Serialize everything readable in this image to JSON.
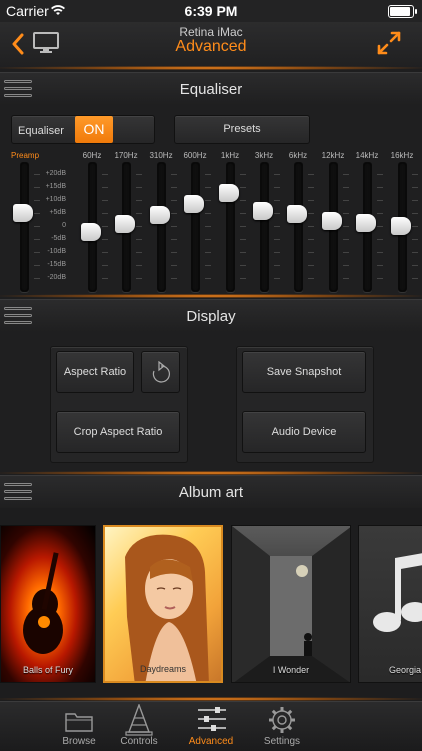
{
  "status": {
    "carrier": "Carrier",
    "time": "6:39 PM"
  },
  "nav": {
    "device": "Retina iMac",
    "title": "Advanced"
  },
  "equaliser": {
    "title": "Equaliser",
    "label": "Equaliser",
    "toggle": "ON",
    "presets": "Presets",
    "preamp_label": "Preamp",
    "preamp_level": 0.62,
    "db_labels": [
      "+20dB",
      "+15dB",
      "+10dB",
      "+5dB",
      "0",
      "-5dB",
      "-10dB",
      "-15dB",
      "-20dB"
    ],
    "bands": [
      {
        "freq": "60Hz",
        "level": 0.45
      },
      {
        "freq": "170Hz",
        "level": 0.52
      },
      {
        "freq": "310Hz",
        "level": 0.6
      },
      {
        "freq": "600Hz",
        "level": 0.7
      },
      {
        "freq": "1kHz",
        "level": 0.8
      },
      {
        "freq": "3kHz",
        "level": 0.64
      },
      {
        "freq": "6kHz",
        "level": 0.61
      },
      {
        "freq": "12kHz",
        "level": 0.55
      },
      {
        "freq": "14kHz",
        "level": 0.53
      },
      {
        "freq": "16kHz",
        "level": 0.5
      }
    ]
  },
  "display": {
    "title": "Display",
    "aspect_ratio": "Aspect Ratio",
    "crop_aspect_ratio": "Crop Aspect Ratio",
    "save_snapshot": "Save Snapshot",
    "audio_device": "Audio Device"
  },
  "album_art": {
    "title": "Album art",
    "albums": [
      {
        "title": "Balls of Fury",
        "selected": false
      },
      {
        "title": "Daydreams",
        "selected": true
      },
      {
        "title": "I Wonder",
        "selected": false
      },
      {
        "title": "Georgia",
        "selected": false
      }
    ]
  },
  "tabs": [
    {
      "label": "Browse",
      "active": false
    },
    {
      "label": "Controls",
      "active": false
    },
    {
      "label": "Advanced",
      "active": true
    },
    {
      "label": "Settings",
      "active": false
    }
  ],
  "colors": {
    "accent": "#ff8c1a",
    "background": "#1e1e1f"
  }
}
